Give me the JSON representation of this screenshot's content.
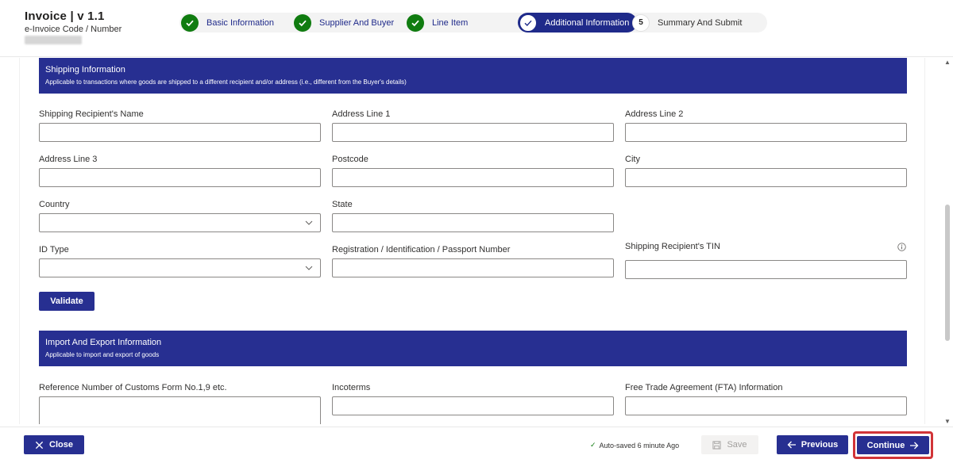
{
  "header": {
    "title": "Invoice | v 1.1",
    "subtitle": "e-Invoice Code / Number"
  },
  "steps": [
    {
      "label": "Basic Information",
      "state": "done"
    },
    {
      "label": "Supplier And Buyer",
      "state": "done"
    },
    {
      "label": "Line Item",
      "state": "done"
    },
    {
      "label": "Additional Information",
      "state": "current"
    },
    {
      "label": "Summary And Submit",
      "state": "todo",
      "number": "5"
    }
  ],
  "shipping": {
    "title": "Shipping Information",
    "description": "Applicable to transactions where goods are shipped to a different recipient and/or address (i.e., different from the Buyer's details)",
    "fields": {
      "recipient_name": "Shipping Recipient's Name",
      "address1": "Address Line 1",
      "address2": "Address Line 2",
      "address3": "Address Line 3",
      "postcode": "Postcode",
      "city": "City",
      "country": "Country",
      "state": "State",
      "id_type": "ID Type",
      "registration": "Registration / Identification / Passport Number",
      "tin": "Shipping Recipient's TIN"
    },
    "validate_label": "Validate"
  },
  "import_export": {
    "title": "Import And Export Information",
    "description": "Applicable to import and export of goods",
    "fields": {
      "customs_ref": "Reference Number of Customs Form No.1,9 etc.",
      "incoterms": "Incoterms",
      "fta": "Free Trade Agreement (FTA) Information"
    }
  },
  "footer": {
    "close_label": "Close",
    "autosave_text": "Auto-saved 6 minute Ago",
    "save_label": "Save",
    "previous_label": "Previous",
    "continue_label": "Continue"
  },
  "colors": {
    "primary": "#272f91",
    "success": "#107c10",
    "highlight": "#d13438"
  }
}
